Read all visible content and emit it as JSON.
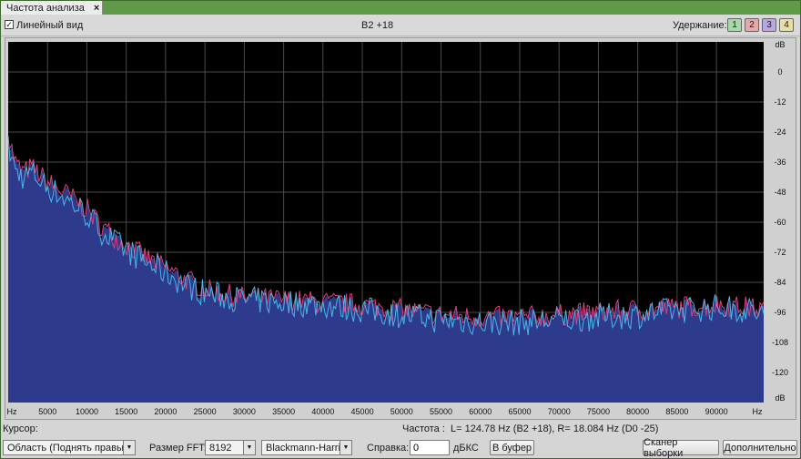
{
  "tab": {
    "title": "Частота  анализа",
    "close": "×"
  },
  "toolbar": {
    "linear_check": "✓",
    "linear_label": "Линейный вид",
    "center_label": "B2 +18",
    "hold_label": "Удержание:",
    "hold_buttons": [
      {
        "label": "1",
        "color": "#a8d8a8"
      },
      {
        "label": "2",
        "color": "#e8a8a8"
      },
      {
        "label": "3",
        "color": "#b8a8e0"
      },
      {
        "label": "4",
        "color": "#e8e0a0"
      }
    ]
  },
  "plot": {
    "x_ticks": [
      "Hz",
      "5000",
      "10000",
      "15000",
      "20000",
      "25000",
      "30000",
      "35000",
      "40000",
      "45000",
      "50000",
      "55000",
      "60000",
      "65000",
      "70000",
      "75000",
      "80000",
      "85000",
      "90000",
      "Hz"
    ],
    "y_ticks": [
      "dB",
      "0",
      "-12",
      "-24",
      "-36",
      "-48",
      "-60",
      "-72",
      "-84",
      "-96",
      "-108",
      "-120",
      "dB"
    ],
    "colors": {
      "background": "#000000",
      "grid": "#4a4a4a",
      "fill": "#2e3a8c",
      "left": "#e0407a",
      "right": "#4ab6e8"
    }
  },
  "chart_data": {
    "type": "area",
    "title": "",
    "xlabel": "Hz",
    "ylabel": "dB",
    "xlim": [
      0,
      96000
    ],
    "ylim": [
      -132,
      12
    ],
    "x": [
      0,
      1000,
      2000,
      3000,
      4000,
      5000,
      6000,
      8000,
      10000,
      12000,
      14000,
      16000,
      18000,
      20000,
      22000,
      24000,
      26000,
      28000,
      30000,
      35000,
      40000,
      45000,
      50000,
      55000,
      60000,
      65000,
      70000,
      75000,
      80000,
      85000,
      90000,
      94000,
      96000
    ],
    "series": [
      {
        "name": "L",
        "values": [
          -26,
          -37,
          -40,
          -38,
          -41,
          -44,
          -46,
          -50,
          -55,
          -62,
          -67,
          -71,
          -75,
          -78,
          -82,
          -85,
          -88,
          -89,
          -90,
          -91,
          -92,
          -93,
          -95,
          -97,
          -98,
          -98,
          -97,
          -96,
          -95,
          -94,
          -93,
          -94,
          -95
        ]
      },
      {
        "name": "R",
        "values": [
          -30,
          -40,
          -42,
          -40,
          -43,
          -46,
          -48,
          -52,
          -57,
          -64,
          -69,
          -73,
          -77,
          -80,
          -84,
          -87,
          -89,
          -90,
          -91,
          -92,
          -93,
          -95,
          -97,
          -99,
          -100,
          -100,
          -99,
          -98,
          -97,
          -95,
          -94,
          -95,
          -97
        ]
      }
    ]
  },
  "status": {
    "cursor_label": "Курсор:",
    "freq_label": "Частота :",
    "freq_value": "L= 124.78 Hz (B2 +18), R= 18.084 Hz (D0 -25)"
  },
  "bottom": {
    "area_select": "Область (Поднять правый)",
    "fft_label": "Размер FFT:",
    "fft_value": "8192",
    "window_value": "Blackmann-Harris",
    "ref_label": "Справка:",
    "ref_value": "0",
    "ref_unit": "дБКС",
    "copy_button": "В буфер",
    "scan_button": "Сканер выборки",
    "more_button": "Дополнительно"
  }
}
